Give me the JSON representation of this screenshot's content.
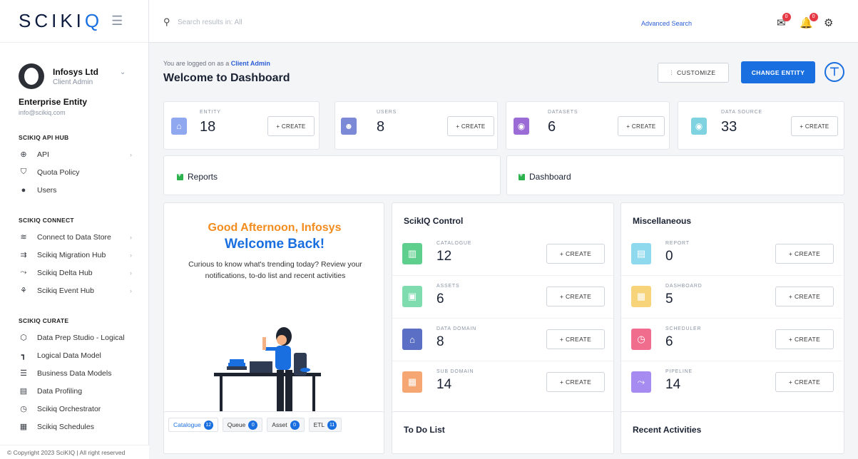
{
  "brand": {
    "logo_text_a": "SCIKI",
    "logo_text_b": "Q"
  },
  "profile": {
    "name": "Infosys Ltd",
    "role": "Client Admin"
  },
  "entity": {
    "title": "Enterprise Entity",
    "email": "info@scikiq.com"
  },
  "sidebar": {
    "sections": [
      {
        "title": "SCIKIQ API HUB",
        "items": [
          {
            "label": "API",
            "icon": "globe-icon",
            "chevron": true
          },
          {
            "label": "Quota Policy",
            "icon": "shield-icon",
            "chevron": false
          },
          {
            "label": "Users",
            "icon": "user-icon",
            "chevron": false
          }
        ]
      },
      {
        "title": "SCIKIQ CONNECT",
        "items": [
          {
            "label": "Connect to Data Store",
            "icon": "database-icon",
            "chevron": true
          },
          {
            "label": "Scikiq Migration Hub",
            "icon": "migration-icon",
            "chevron": true
          },
          {
            "label": "Scikiq Delta Hub",
            "icon": "delta-icon",
            "chevron": true
          },
          {
            "label": "Scikiq Event Hub",
            "icon": "event-icon",
            "chevron": true
          }
        ]
      },
      {
        "title": "SCIKIQ CURATE",
        "items": [
          {
            "label": "Data Prep Studio - Logical",
            "icon": "cube-icon",
            "chevron": false
          },
          {
            "label": "Logical Data Model",
            "icon": "model-icon",
            "chevron": false
          },
          {
            "label": "Business Data Models",
            "icon": "list-icon",
            "chevron": false
          },
          {
            "label": "Data Profiling",
            "icon": "profiling-icon",
            "chevron": false
          },
          {
            "label": "Scikiq Orchestrator",
            "icon": "orchestrator-icon",
            "chevron": false
          },
          {
            "label": "Scikiq Schedules",
            "icon": "calendar-icon",
            "chevron": false
          }
        ]
      }
    ]
  },
  "footer": "© Copyright 2023 SciKIQ | All right reserved",
  "header": {
    "search_placeholder": "Search results in: All",
    "advanced_search": "Advanced Search",
    "notif_badge_1": "0",
    "notif_badge_2": "0"
  },
  "main": {
    "logged_prefix": "You are logged on as a ",
    "logged_role": "Client Admin",
    "title": "Welcome to Dashboard",
    "customize_label": "CUSTOMIZE",
    "change_entity_label": "CHANGE ENTITY",
    "stats": [
      {
        "label": "ENTITY",
        "value": "18",
        "create": "+ CREATE",
        "color": "#8fa8f0",
        "icon": "bank-icon"
      },
      {
        "label": "USERS",
        "value": "8",
        "create": "+ CREATE",
        "color": "#7b89d6",
        "icon": "users-icon"
      },
      {
        "label": "DATASETS",
        "value": "6",
        "create": "+ CREATE",
        "color": "#9b6cd6",
        "icon": "datasets-icon"
      },
      {
        "label": "DATA SOURCE",
        "value": "33",
        "create": "+ CREATE",
        "color": "#7fd3e0",
        "icon": "datasource-icon"
      }
    ],
    "reports_label": "Reports",
    "dashboard_label": "Dashboard",
    "greeting_line1": "Good Afternoon, Infosys",
    "greeting_line2": "Welcome Back!",
    "greeting_text": "Curious to know what's trending today? Review your notifications, to-do list and recent activities",
    "control": {
      "title": "ScikIQ Control",
      "rows": [
        {
          "label": "CATALOGUE",
          "value": "12",
          "create": "+ CREATE",
          "color": "#5fcf8e",
          "icon": "catalogue-icon"
        },
        {
          "label": "ASSETS",
          "value": "6",
          "create": "+ CREATE",
          "color": "#7fdcae",
          "icon": "assets-icon"
        },
        {
          "label": "DATA DOMAIN",
          "value": "8",
          "create": "+ CREATE",
          "color": "#5b6fc4",
          "icon": "domain-icon"
        },
        {
          "label": "SUB DOMAIN",
          "value": "14",
          "create": "+ CREATE",
          "color": "#f5a673",
          "icon": "subdomain-icon"
        }
      ]
    },
    "misc": {
      "title": "Miscellaneous",
      "rows": [
        {
          "label": "REPORT",
          "value": "0",
          "create": "+ CREATE",
          "color": "#8fd9ee",
          "icon": "report-icon"
        },
        {
          "label": "DASHBOARD",
          "value": "5",
          "create": "+ CREATE",
          "color": "#f7d37a",
          "icon": "dashboard-icon"
        },
        {
          "label": "SCHEDULER",
          "value": "6",
          "create": "+ CREATE",
          "color": "#f06d8e",
          "icon": "scheduler-icon"
        },
        {
          "label": "PIPELINE",
          "value": "14",
          "create": "+ CREATE",
          "color": "#a68bf0",
          "icon": "pipeline-icon"
        }
      ]
    },
    "tabs": [
      {
        "label": "Catalogue",
        "count": "12"
      },
      {
        "label": "Queue",
        "count": "0"
      },
      {
        "label": "Asset",
        "count": "0"
      },
      {
        "label": "ETL",
        "count": "11"
      }
    ],
    "todo_title": "To Do List",
    "recent_title": "Recent Activities"
  }
}
